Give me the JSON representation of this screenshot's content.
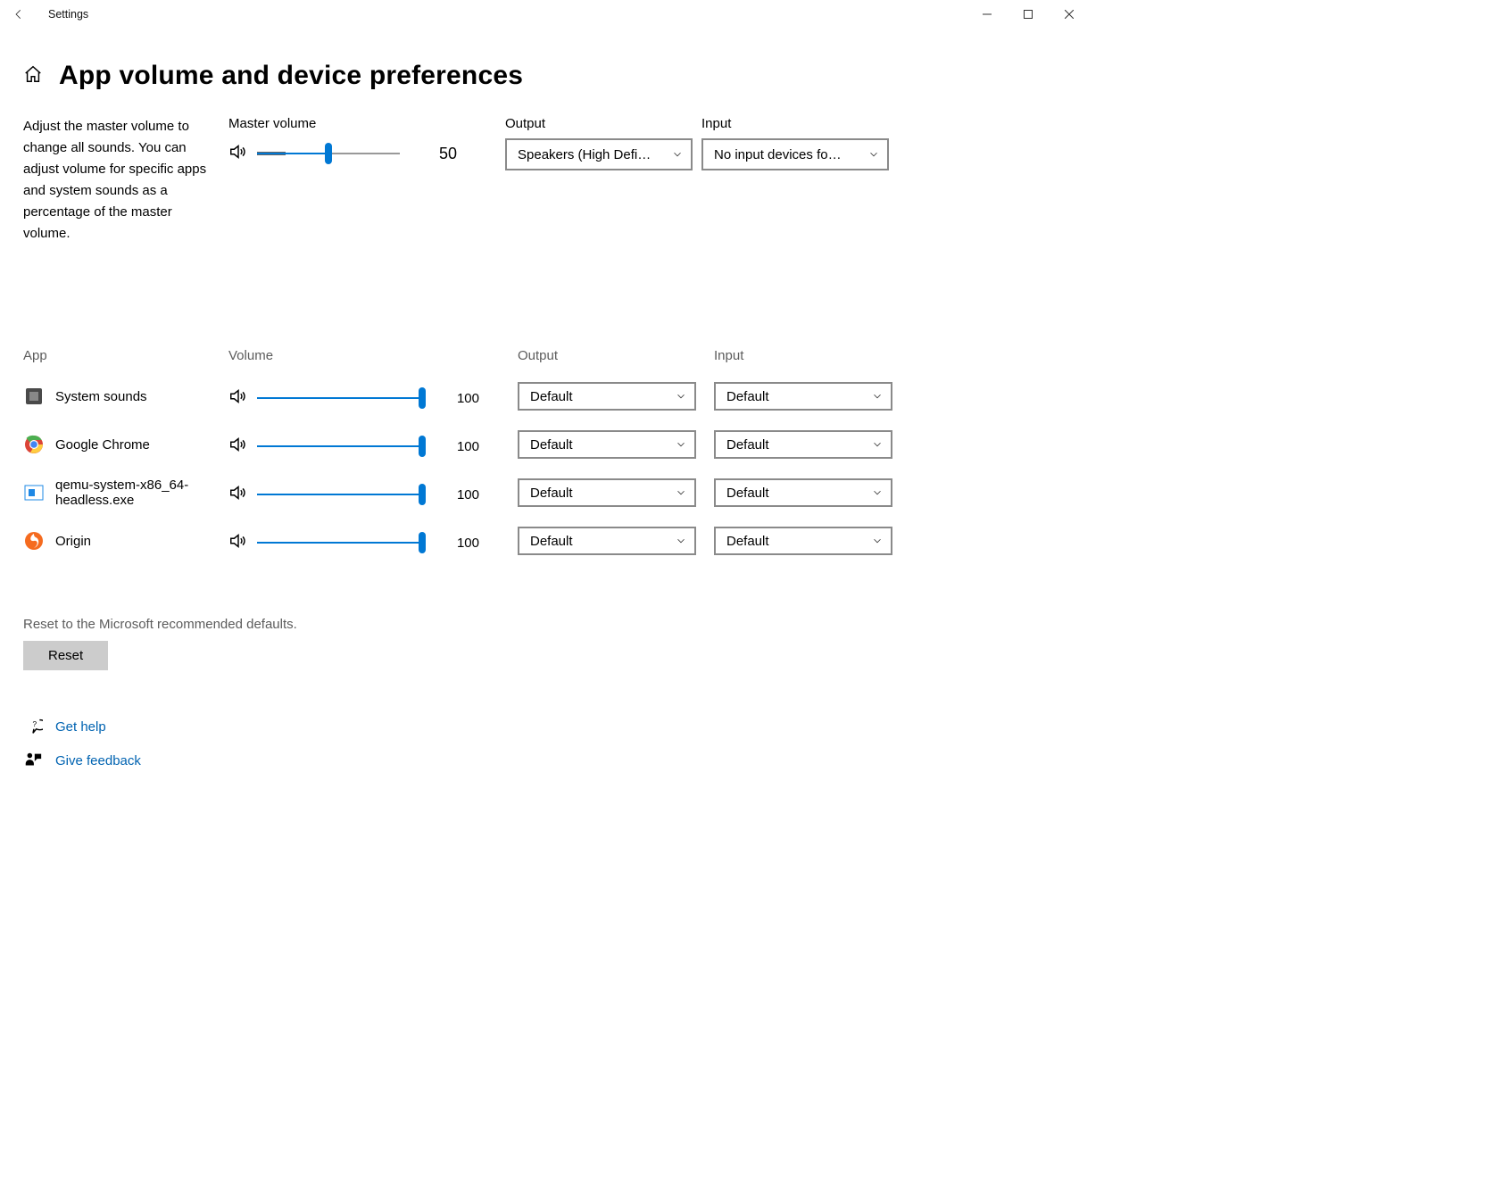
{
  "window": {
    "title": "Settings"
  },
  "page": {
    "heading": "App volume and device preferences",
    "description": "Adjust the master volume to change all sounds. You can adjust volume for specific apps and system sounds as a percentage of the master volume."
  },
  "master": {
    "label": "Master volume",
    "value": 50,
    "value_text": "50",
    "output_label": "Output",
    "input_label": "Input",
    "output_selected": "Speakers (High Defi…",
    "input_selected": "No input devices fo…"
  },
  "columns": {
    "app": "App",
    "volume": "Volume",
    "output": "Output",
    "input": "Input"
  },
  "apps": [
    {
      "name": "System sounds",
      "value": 100,
      "value_text": "100",
      "output": "Default",
      "input": "Default",
      "icon": "system"
    },
    {
      "name": "Google Chrome",
      "value": 100,
      "value_text": "100",
      "output": "Default",
      "input": "Default",
      "icon": "chrome"
    },
    {
      "name": "qemu-system-x86_64-headless.exe",
      "value": 100,
      "value_text": "100",
      "output": "Default",
      "input": "Default",
      "icon": "qemu"
    },
    {
      "name": "Origin",
      "value": 100,
      "value_text": "100",
      "output": "Default",
      "input": "Default",
      "icon": "origin"
    }
  ],
  "reset": {
    "text": "Reset to the Microsoft recommended defaults.",
    "button": "Reset"
  },
  "links": {
    "help": "Get help",
    "feedback": "Give feedback"
  }
}
